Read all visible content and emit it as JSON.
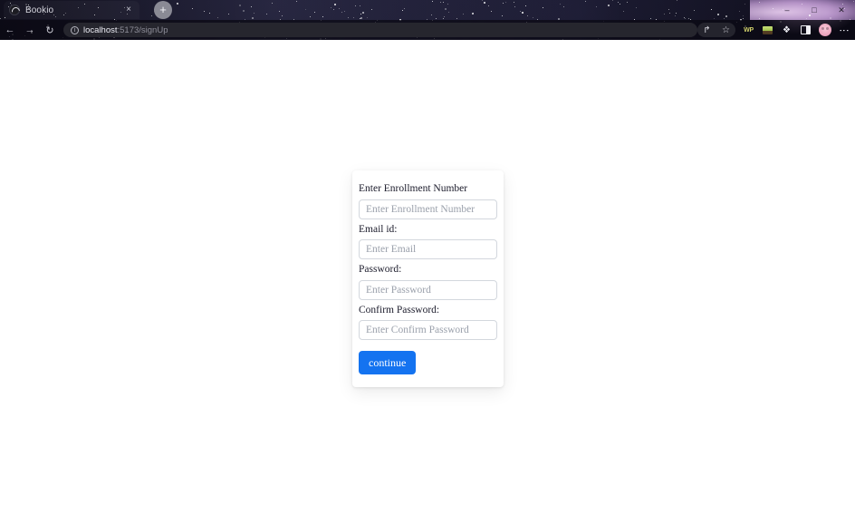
{
  "browser": {
    "tab": {
      "title": "Bookio",
      "favicon_name": "bookio-favicon",
      "close_label": "×"
    },
    "new_tab_label": "+",
    "nav": {
      "back_label": "←",
      "forward_label": "→",
      "reload_label": "↻"
    },
    "url": {
      "host": "localhost",
      "path": ":5173/signUp",
      "full": "localhost:5173/signUp",
      "info_icon_label": "i"
    },
    "toolbar": {
      "share_label": "↱",
      "bookmark_label": "☆",
      "extension_wp_label": "WP",
      "extension_green_name": "green-square-extension-icon",
      "extension_puzzle_label": "❖",
      "sidebar_panel_name": "sidebar-panel-icon",
      "profile_name": "profile-avatar",
      "menu_label": "⋮"
    },
    "window_controls": {
      "minimize": "–",
      "maximize": "□",
      "close": "✕"
    }
  },
  "page": {
    "form": {
      "fields": [
        {
          "label": "Enter Enrollment Number",
          "placeholder": "Enter Enrollment Number",
          "value": "",
          "type": "text"
        },
        {
          "label": "Email id:",
          "placeholder": "Enter Email",
          "value": "",
          "type": "text"
        },
        {
          "label": "Password:",
          "placeholder": "Enter Password",
          "value": "",
          "type": "text"
        },
        {
          "label": "Confirm Password:",
          "placeholder": "Enter Confirm Password",
          "value": "",
          "type": "text"
        }
      ],
      "submit_label": "continue"
    }
  },
  "colors": {
    "accent_blue": "#1473f0",
    "page_background": "#ffffff",
    "chrome_dark": "#0a0912",
    "input_border": "#d3d7dd",
    "placeholder_text": "#9aa0ab"
  }
}
